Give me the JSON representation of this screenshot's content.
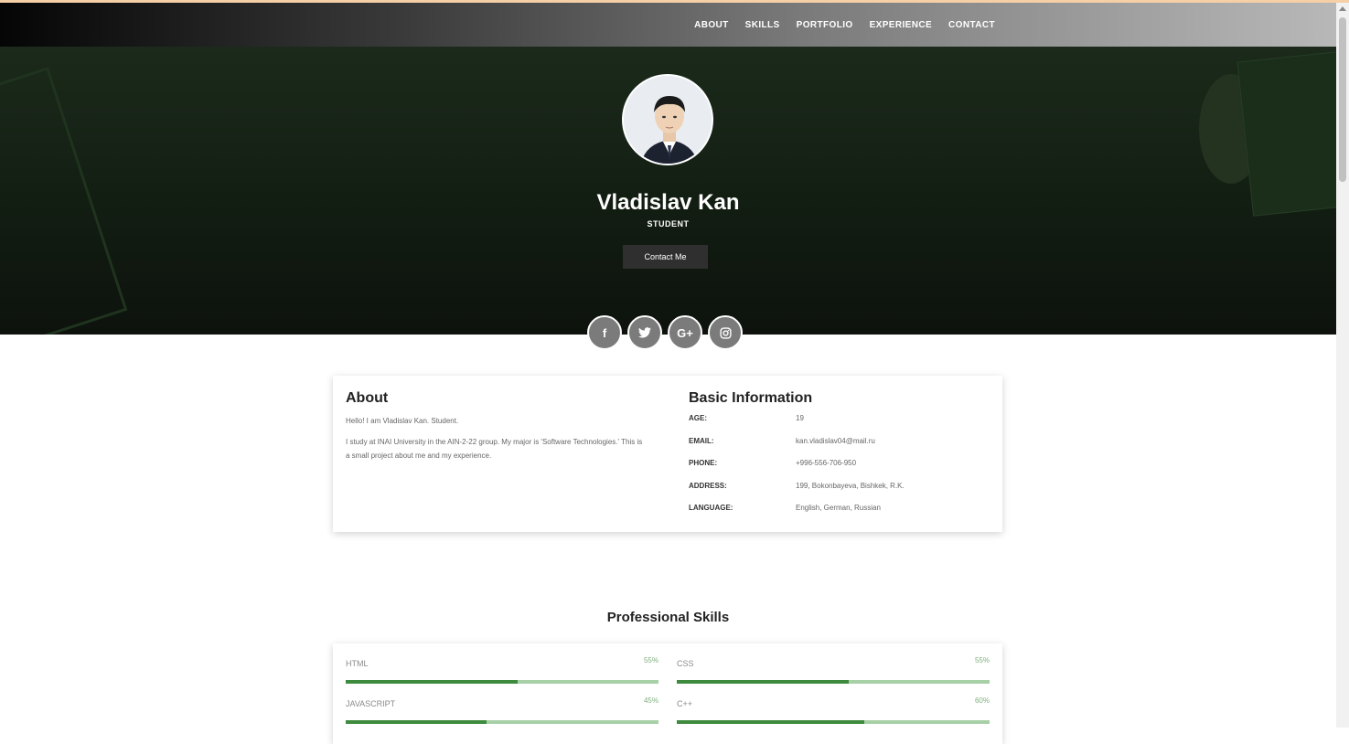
{
  "nav": {
    "items": [
      "ABOUT",
      "SKILLS",
      "PORTFOLIO",
      "EXPERIENCE",
      "CONTACT"
    ]
  },
  "hero": {
    "name": "Vladislav Kan",
    "role": "STUDENT",
    "cta_label": "Contact Me",
    "socials": [
      {
        "icon": "facebook-icon",
        "glyph": "f"
      },
      {
        "icon": "twitter-icon",
        "glyph": "🐦"
      },
      {
        "icon": "google-plus-icon",
        "glyph": "G+"
      },
      {
        "icon": "instagram-icon",
        "glyph": "◎"
      }
    ]
  },
  "about": {
    "title": "About",
    "p1": "Hello! I am Vladislav Kan. Student.",
    "p2": "I study at INAI University in the AIN-2-22 group. My major is 'Software Technologies.' This is a small project about me and my experience."
  },
  "basic_info": {
    "title": "Basic Information",
    "rows": [
      {
        "key": "AGE:",
        "value": "19"
      },
      {
        "key": "EMAIL:",
        "value": "kan.vladislav04@mail.ru"
      },
      {
        "key": "PHONE:",
        "value": "+996-556-706-950"
      },
      {
        "key": "ADDRESS:",
        "value": "199, Bokonbayeva, Bishkek, R.K."
      },
      {
        "key": "LANGUAGE:",
        "value": "English, German, Russian"
      }
    ]
  },
  "skills": {
    "title": "Professional Skills",
    "items": [
      {
        "label": "HTML",
        "percent_label": "55%",
        "percent": 55
      },
      {
        "label": "CSS",
        "percent_label": "55%",
        "percent": 55
      },
      {
        "label": "JAVASCRIPT",
        "percent_label": "45%",
        "percent": 45
      },
      {
        "label": "C++",
        "percent_label": "60%",
        "percent": 60
      }
    ]
  },
  "colors": {
    "accent_green": "#3e8a3e",
    "bar_track": "#a7d0a7",
    "hero_bg": "#142014"
  }
}
